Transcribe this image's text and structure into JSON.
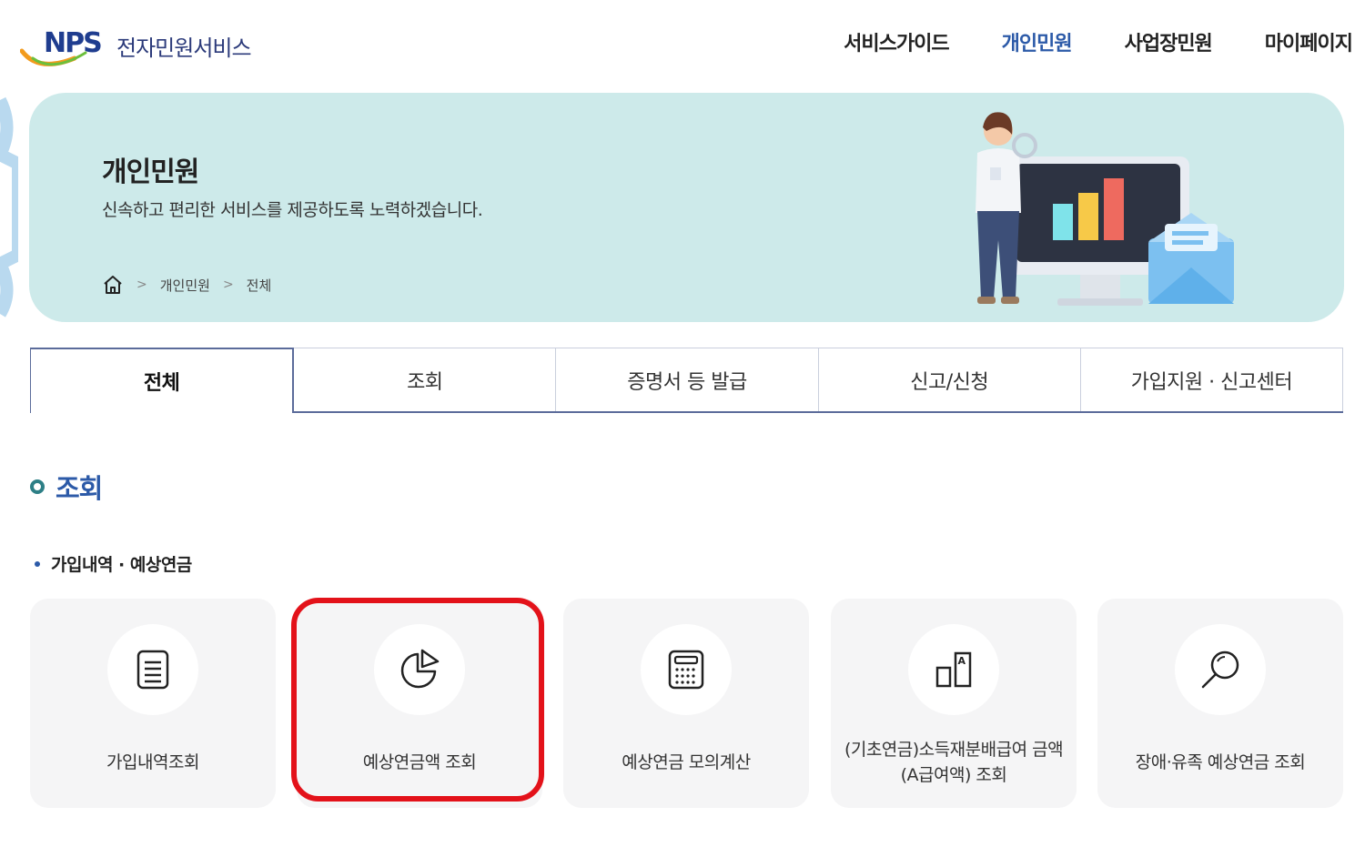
{
  "header": {
    "logo_mark": "NPS",
    "logo_text": "전자민원서비스",
    "nav": [
      {
        "label": "서비스가이드",
        "active": false
      },
      {
        "label": "개인민원",
        "active": true
      },
      {
        "label": "사업장민원",
        "active": false
      },
      {
        "label": "마이페이지",
        "active": false
      }
    ]
  },
  "banner": {
    "title": "개인민원",
    "subtitle": "신속하고 편리한 서비스를 제공하도록 노력하겠습니다.",
    "breadcrumb": [
      "개인민원",
      "전체"
    ]
  },
  "tabs": [
    "전체",
    "조회",
    "증명서 등 발급",
    "신고/신청",
    "가입지원 · 신고센터"
  ],
  "section": {
    "title": "조회",
    "subsection": "가입내역 · 예상연금",
    "cards": [
      {
        "label": "가입내역조회",
        "icon": "document-icon"
      },
      {
        "label": "예상연금액 조회",
        "icon": "pie-chart-icon"
      },
      {
        "label": "예상연금 모의계산",
        "icon": "calculator-icon"
      },
      {
        "label": "(기초연금)소득재분배급여 금액(A급여액) 조회",
        "icon": "bar-a-icon"
      },
      {
        "label": "장애·유족 예상연금 조회",
        "icon": "magnifier-icon"
      }
    ]
  },
  "colors": {
    "accent": "#2c5aa8",
    "banner_bg": "#cdeaea",
    "highlight": "#e3121a",
    "card_bg": "#f5f5f6"
  }
}
